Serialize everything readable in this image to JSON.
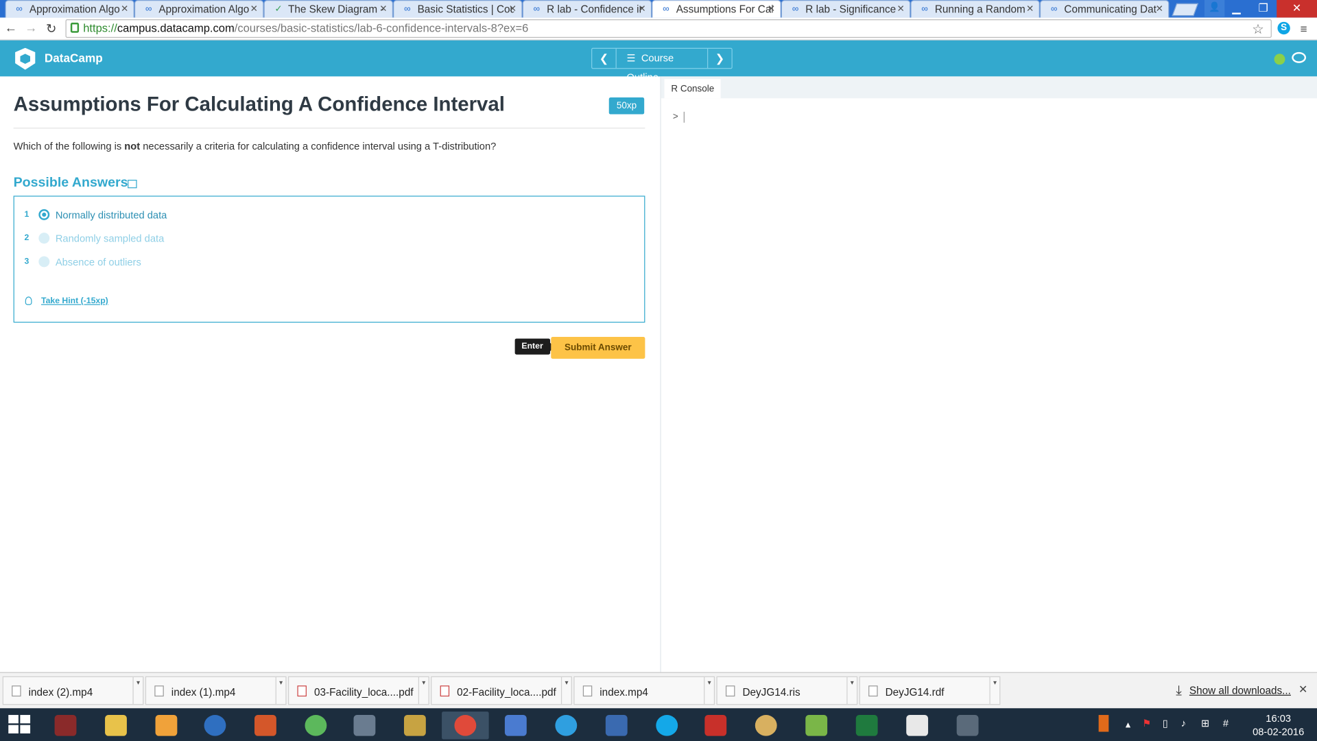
{
  "browser": {
    "tabs": [
      {
        "title": "Approximation Algo",
        "favicon": "datacamp-infinity-icon"
      },
      {
        "title": "Approximation Algo",
        "favicon": "datacamp-infinity-icon"
      },
      {
        "title": "The Skew Diagram -",
        "favicon": "rosalind-check-icon"
      },
      {
        "title": "Basic Statistics | Cou",
        "favicon": "datacamp-infinity-icon"
      },
      {
        "title": "R lab - Confidence ir",
        "favicon": "datacamp-infinity-icon"
      },
      {
        "title": "Assumptions For Cal",
        "favicon": "datacamp-infinity-icon",
        "active": true
      },
      {
        "title": "R lab - Significance",
        "favicon": "datacamp-infinity-icon"
      },
      {
        "title": "Running a Random",
        "favicon": "datacamp-infinity-icon"
      },
      {
        "title": "Communicating Dat",
        "favicon": "datacamp-infinity-icon"
      }
    ],
    "url_scheme": "https://",
    "url_host": "campus.datacamp.com",
    "url_path": "/courses/basic-statistics/lab-6-confidence-intervals-8?ex=6"
  },
  "header": {
    "brand": "DataCamp",
    "course_outline": "Course Outline"
  },
  "exercise": {
    "title": "Assumptions For Calculating A Confidence Interval",
    "xp": "50xp",
    "question_before": "Which of the following is ",
    "question_bold": "not",
    "question_after": " necessarily a criteria for calculating a confidence interval using a T-distribution?",
    "possible_answers_title": "Possible Answers",
    "answers": [
      {
        "number": "1",
        "label": "Normally distributed data",
        "selected": true
      },
      {
        "number": "2",
        "label": "Randomly sampled data",
        "selected": false
      },
      {
        "number": "3",
        "label": "Absence of outliers",
        "selected": false
      }
    ],
    "hint": "Take Hint (-15xp)",
    "enter_key": "Enter",
    "submit": "Submit Answer"
  },
  "console": {
    "tab": "R Console",
    "prompt": ">"
  },
  "downloads": {
    "items": [
      {
        "name": "index (2).mp4",
        "type": "video"
      },
      {
        "name": "index (1).mp4",
        "type": "video"
      },
      {
        "name": "03-Facility_loca....pdf",
        "type": "pdf"
      },
      {
        "name": "02-Facility_loca....pdf",
        "type": "pdf"
      },
      {
        "name": "index.mp4",
        "type": "video"
      },
      {
        "name": "DeyJG14.ris",
        "type": "file"
      },
      {
        "name": "DeyJG14.rdf",
        "type": "file"
      }
    ],
    "show_all": "Show all downloads..."
  },
  "taskbar": {
    "time": "16:03",
    "date": "08-02-2016"
  },
  "colors": {
    "accent": "#33a9ce",
    "submit": "#fdc347",
    "taskbar": "#1c2d3e"
  }
}
